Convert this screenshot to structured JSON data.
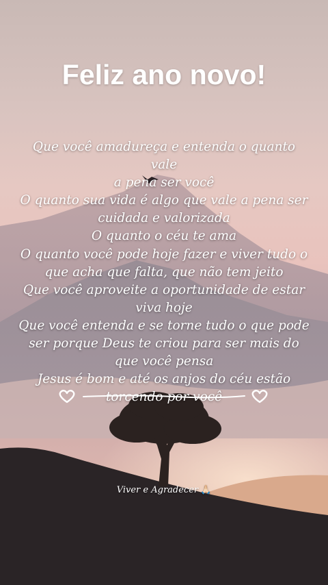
{
  "post": {
    "title": "Feliz ano novo!",
    "lines": [
      "Que você amadureça e entenda o quanto vale",
      "a pena ser você",
      "O quanto sua vida é algo que vale a pena ser",
      "cuidada e valorizada",
      "O quanto o céu te ama",
      "O quanto você pode hoje fazer e viver tudo o",
      "que acha que falta, que não tem jeito",
      "Que você aproveite a oportunidade de estar",
      "viva hoje",
      "Que você entenda e se torne tudo o que pode",
      "ser porque Deus te criou para ser mais do",
      "que você pensa",
      "Jesus é bom e até os anjos do céu estão",
      "torcendo por você"
    ],
    "signature": "Viver e Agradecer",
    "signature_emoji": "🙏🏻"
  },
  "icons": {
    "divider": "heart-divider-icon",
    "bird": "bird-icon",
    "emoji": "praying-hands-icon"
  },
  "colors": {
    "text": "#ffffff",
    "sky_top": "#c9b9b5",
    "sky_mid": "#e9c3bd",
    "hill": "#2a2426"
  }
}
